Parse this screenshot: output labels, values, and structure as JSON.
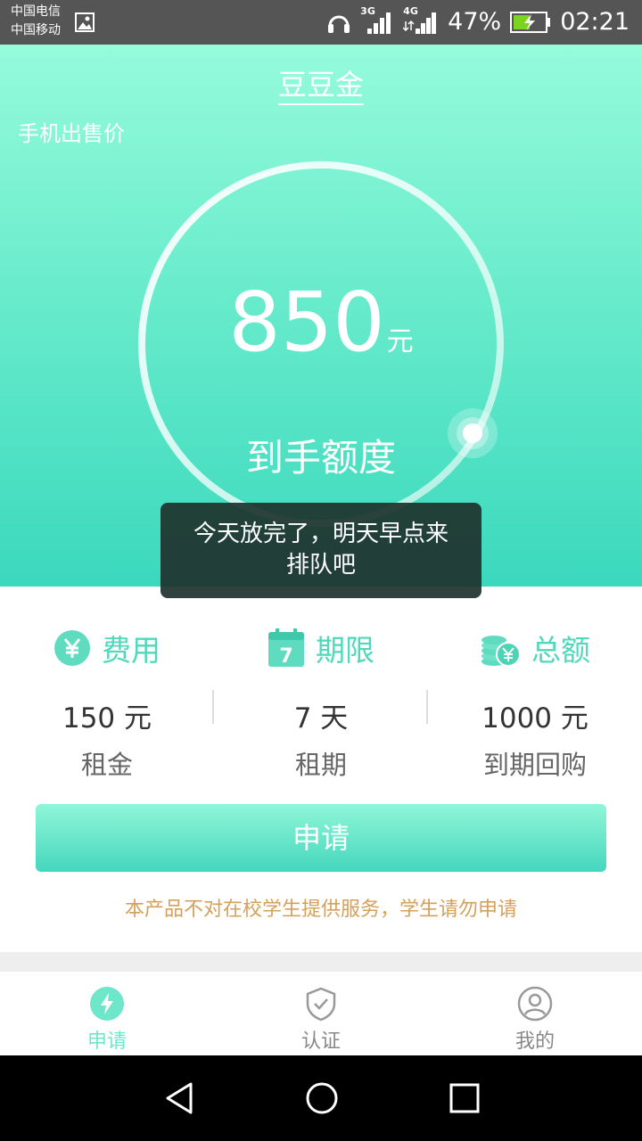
{
  "status_bar": {
    "carrier1": "中国电信",
    "carrier2": "中国移动",
    "net1": "3G",
    "net2": "4G",
    "battery": "47%",
    "time": "02:21"
  },
  "header": {
    "title": "豆豆金",
    "subtitle": "手机出售价"
  },
  "quota": {
    "value": "850",
    "unit": "元",
    "label": "到手额度"
  },
  "toast": {
    "message": "今天放完了，明天早点来排队吧"
  },
  "info": [
    {
      "title": "费用",
      "value": "150 元",
      "sub": "租金",
      "icon": "yen-coin-icon"
    },
    {
      "title": "期限",
      "value": "7 天",
      "sub": "租期",
      "icon": "calendar-icon",
      "icon_text": "7"
    },
    {
      "title": "总额",
      "value": "1000 元",
      "sub": "到期回购",
      "icon": "coin-stack-icon"
    }
  ],
  "apply_button": "申请",
  "notice": "本产品不对在校学生提供服务，学生请勿申请",
  "tabs": [
    {
      "label": "申请",
      "icon": "lightning-icon",
      "active": true
    },
    {
      "label": "认证",
      "icon": "shield-check-icon",
      "active": false
    },
    {
      "label": "我的",
      "icon": "user-icon",
      "active": false
    }
  ],
  "colors": {
    "accent": "#4fd8bb",
    "hero_top": "#95fbdb",
    "hero_bottom": "#3bd8bd",
    "notice": "#d4a05b",
    "tab_active": "#6ee6c9"
  }
}
